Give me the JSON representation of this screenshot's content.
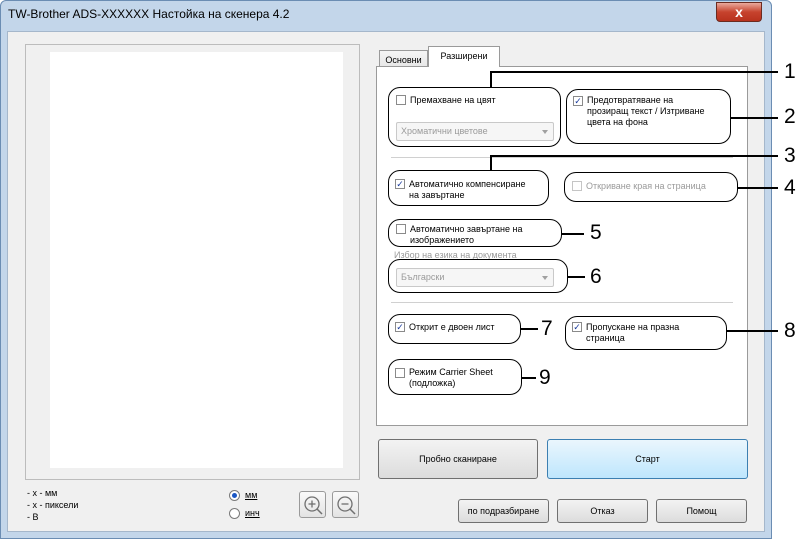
{
  "window": {
    "title": "TW-Brother ADS-XXXXXX Настойка на скенера 4.2",
    "close_glyph": "x"
  },
  "tabs": [
    {
      "label": "Основни"
    },
    {
      "label": "Разширени"
    }
  ],
  "options": {
    "color_drop": {
      "label": "Премахване на цвят",
      "checked": false
    },
    "color_select": {
      "value": "Хроматични цветове"
    },
    "bleed_through": {
      "line1": "Предотвратяване на",
      "line2": "прозиращ текст / Изтриване",
      "line3": "цвета на фона",
      "checked": true
    },
    "auto_deskew": {
      "line1": "Автоматично компенсиране",
      "line2": "на завъртане",
      "checked": true
    },
    "detect_page_end": {
      "label": "Откриване края на страница",
      "checked": false
    },
    "auto_rotate": {
      "line1": "Автоматично завъртане на",
      "line2": "изображението",
      "checked": false
    },
    "language_label": "Избор на езика на документа",
    "language_select": {
      "value": "Български"
    },
    "double_feed": {
      "label": "Открит е двоен лист",
      "checked": true
    },
    "skip_blank": {
      "line1": "Пропускане на празна",
      "line2": "страница",
      "checked": true
    },
    "carrier_sheet": {
      "line1": "Режим Carrier Sheet",
      "line2": "(подложка)",
      "checked": false
    }
  },
  "callouts": [
    "1",
    "2",
    "3",
    "4",
    "5",
    "6",
    "7",
    "8",
    "9"
  ],
  "info": {
    "line1": "- x - мм",
    "line2": "- x - пиксели",
    "line3": "- B"
  },
  "units": {
    "mm": "мм",
    "inch": "инч",
    "selected": "мм"
  },
  "buttons": {
    "preview": "Пробно сканиране",
    "start": "Старт",
    "default": "по подразбиране",
    "cancel": "Отказ",
    "help": "Помощ"
  },
  "checkmark": "✓"
}
